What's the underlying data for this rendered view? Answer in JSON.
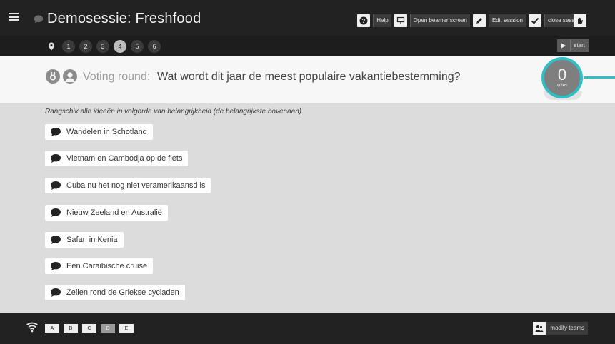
{
  "header": {
    "title": "Demosessie: Freshfood",
    "actions": {
      "help": "Help",
      "beamer": "Open beamer screen",
      "edit": "Edit session",
      "close": "close session"
    }
  },
  "steps": {
    "items": [
      "1",
      "2",
      "3",
      "4",
      "5",
      "6"
    ],
    "active": "4",
    "start_label": "start"
  },
  "round": {
    "label": "Voting round:",
    "question": "Wat wordt dit jaar de meest populaire vakantiebestemming?",
    "votes_count": "0",
    "votes_label": "votes"
  },
  "instruction": "Rangschik alle ideeën in volgorde van belangrijkheid (de belangrijkste bovenaan).",
  "ideas": [
    "Wandelen in Schotland",
    "Vietnam en Cambodja op de fiets",
    "Cuba nu het nog niet veramerikaansd is",
    "Nieuw Zeeland en Australië",
    "Safari in Kenia",
    "Een Caraibische cruise",
    "Zeilen rond de Griekse cycladen"
  ],
  "footer": {
    "teams": [
      "A",
      "B",
      "C",
      "D",
      "E"
    ],
    "active_team": "D",
    "modify_label": "modify teams"
  },
  "colors": {
    "accent": "#2ec0c4",
    "topbar": "#222222",
    "content_bg": "#dcdcdc"
  }
}
